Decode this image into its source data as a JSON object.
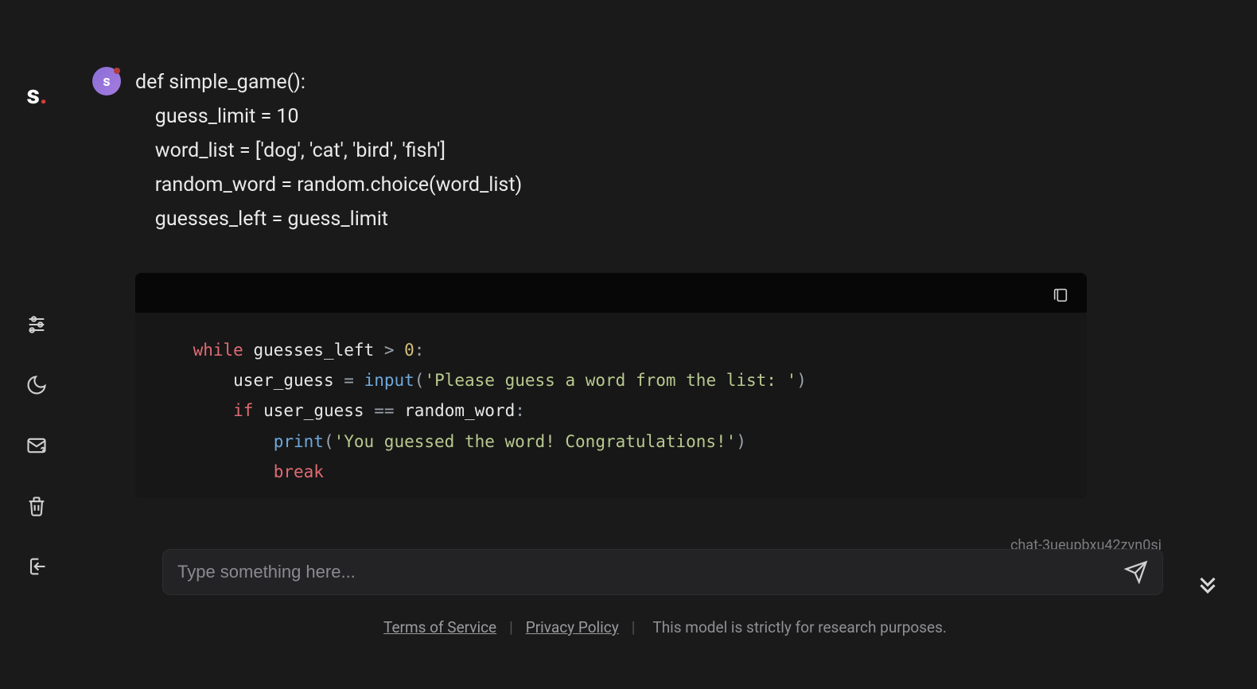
{
  "logo": {
    "text": "s",
    "dot": "."
  },
  "avatar": {
    "letter": "s"
  },
  "message": {
    "lines": [
      "def simple_game():",
      "    guess_limit = 10",
      "    word_list = ['dog', 'cat', 'bird', 'fish']",
      "    random_word = random.choice(word_list)",
      "    guesses_left = guess_limit"
    ]
  },
  "code_block": {
    "tokens": [
      [
        [
          "    ",
          "plain"
        ],
        [
          "while",
          "kw"
        ],
        [
          " ",
          "plain"
        ],
        [
          "guesses_left",
          "id"
        ],
        [
          " ",
          "plain"
        ],
        [
          ">",
          "op"
        ],
        [
          " ",
          "plain"
        ],
        [
          "0",
          "num"
        ],
        [
          ":",
          "op"
        ]
      ],
      [
        [
          "        ",
          "plain"
        ],
        [
          "user_guess",
          "id"
        ],
        [
          " ",
          "plain"
        ],
        [
          "=",
          "op"
        ],
        [
          " ",
          "plain"
        ],
        [
          "input",
          "fn"
        ],
        [
          "(",
          "op"
        ],
        [
          "'Please guess a word from the list: '",
          "str"
        ],
        [
          ")",
          "op"
        ]
      ],
      [
        [
          "        ",
          "plain"
        ],
        [
          "if",
          "kw"
        ],
        [
          " ",
          "plain"
        ],
        [
          "user_guess",
          "id"
        ],
        [
          " ",
          "plain"
        ],
        [
          "==",
          "op"
        ],
        [
          " ",
          "plain"
        ],
        [
          "random_word",
          "id"
        ],
        [
          ":",
          "op"
        ]
      ],
      [
        [
          "            ",
          "plain"
        ],
        [
          "print",
          "fn"
        ],
        [
          "(",
          "op"
        ],
        [
          "'You guessed the word! Congratulations!'",
          "str"
        ],
        [
          ")",
          "op"
        ]
      ],
      [
        [
          "            ",
          "plain"
        ],
        [
          "break",
          "kw"
        ]
      ]
    ]
  },
  "chat_id": "chat-3ueupbxu42zvn0si",
  "input": {
    "placeholder": "Type something here...",
    "value": ""
  },
  "footer": {
    "terms": "Terms of Service",
    "privacy": "Privacy Policy",
    "note": "This model is strictly for research purposes."
  }
}
